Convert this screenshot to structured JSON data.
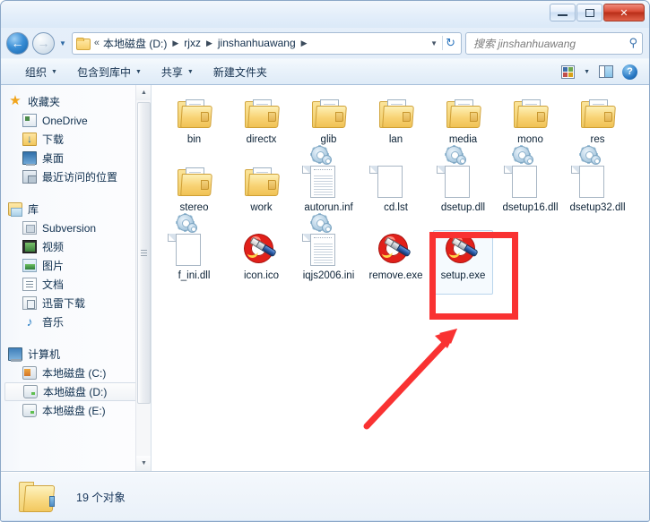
{
  "window": {
    "controls": {
      "minimize": "–",
      "maximize": "□",
      "close": "✕"
    }
  },
  "nav": {
    "back_icon": "←",
    "forward_icon": "→",
    "history_caret": "▼",
    "breadcrumb": {
      "chevron": "«",
      "segments": [
        "本地磁盘 (D:)",
        "rjxz",
        "jinshanhuawang"
      ],
      "separator": "▶",
      "dropdown_caret": "▼",
      "refresh_icon": "↻"
    },
    "search": {
      "placeholder": "搜索 jinshanhuawang",
      "icon": "⚲"
    }
  },
  "toolbar": {
    "items": [
      {
        "label": "组织",
        "has_caret": true
      },
      {
        "label": "包含到库中",
        "has_caret": true
      },
      {
        "label": "共享",
        "has_caret": true
      },
      {
        "label": "新建文件夹",
        "has_caret": false
      }
    ],
    "view_caret": "▼",
    "help_label": "?"
  },
  "sidebar": {
    "groups": [
      {
        "head": {
          "label": "收藏夹",
          "icon": "star-icon",
          "icon_class": "ic-star",
          "glyph": "★"
        },
        "items": [
          {
            "label": "OneDrive",
            "icon": "onedrive-icon",
            "icon_class": "ic-onedrive"
          },
          {
            "label": "下载",
            "icon": "downloads-icon",
            "icon_class": "ic-download"
          },
          {
            "label": "桌面",
            "icon": "desktop-icon",
            "icon_class": "ic-desktop"
          },
          {
            "label": "最近访问的位置",
            "icon": "recent-places-icon",
            "icon_class": "ic-recent"
          }
        ]
      },
      {
        "head": {
          "label": "库",
          "icon": "library-icon",
          "icon_class": "ic-lib",
          "glyph": ""
        },
        "items": [
          {
            "label": "Subversion",
            "icon": "subversion-icon",
            "icon_class": "ic-svn"
          },
          {
            "label": "视频",
            "icon": "videos-icon",
            "icon_class": "ic-video"
          },
          {
            "label": "图片",
            "icon": "pictures-icon",
            "icon_class": "ic-pic"
          },
          {
            "label": "文档",
            "icon": "documents-icon",
            "icon_class": "ic-doc"
          },
          {
            "label": "迅雷下载",
            "icon": "thunder-download-icon",
            "icon_class": "ic-thunder"
          },
          {
            "label": "音乐",
            "icon": "music-icon",
            "icon_class": "ic-music",
            "glyph": "♪"
          }
        ]
      },
      {
        "head": {
          "label": "计算机",
          "icon": "computer-icon",
          "icon_class": "ic-computer",
          "glyph": ""
        },
        "items": [
          {
            "label": "本地磁盘 (C:)",
            "icon": "drive-c-icon",
            "icon_class": "ic-drivec",
            "selected": false
          },
          {
            "label": "本地磁盘 (D:)",
            "icon": "drive-d-icon",
            "icon_class": "ic-drive",
            "selected": true
          },
          {
            "label": "本地磁盘 (E:)",
            "icon": "drive-e-icon",
            "icon_class": "ic-drive",
            "selected": false
          }
        ]
      }
    ],
    "scroll": {
      "up": "▲",
      "down": "▼"
    }
  },
  "files": [
    {
      "name": "bin",
      "type": "folder",
      "selected": false
    },
    {
      "name": "directx",
      "type": "folder",
      "selected": false
    },
    {
      "name": "glib",
      "type": "folder",
      "selected": false
    },
    {
      "name": "lan",
      "type": "folder",
      "selected": false
    },
    {
      "name": "media",
      "type": "folder",
      "selected": false
    },
    {
      "name": "mono",
      "type": "folder",
      "selected": false
    },
    {
      "name": "res",
      "type": "folder",
      "selected": false
    },
    {
      "name": "stereo",
      "type": "folder",
      "selected": false
    },
    {
      "name": "work",
      "type": "folder",
      "selected": false
    },
    {
      "name": "autorun.inf",
      "type": "ini",
      "selected": false
    },
    {
      "name": "cd.lst",
      "type": "file",
      "selected": false
    },
    {
      "name": "dsetup.dll",
      "type": "dll",
      "selected": false
    },
    {
      "name": "dsetup16.dll",
      "type": "dll",
      "selected": false
    },
    {
      "name": "dsetup32.dll",
      "type": "dll",
      "selected": false
    },
    {
      "name": "f_ini.dll",
      "type": "dll",
      "selected": false
    },
    {
      "name": "icon.ico",
      "type": "exe",
      "selected": false
    },
    {
      "name": "iqjs2006.ini",
      "type": "ini",
      "selected": false
    },
    {
      "name": "remove.exe",
      "type": "exe",
      "selected": false
    },
    {
      "name": "setup.exe",
      "type": "exe",
      "selected": true
    }
  ],
  "status": {
    "count_text": "19 个对象"
  },
  "annotation": {
    "highlight_color": "#f93232",
    "arrow_color": "#f93232",
    "target": "setup.exe"
  }
}
